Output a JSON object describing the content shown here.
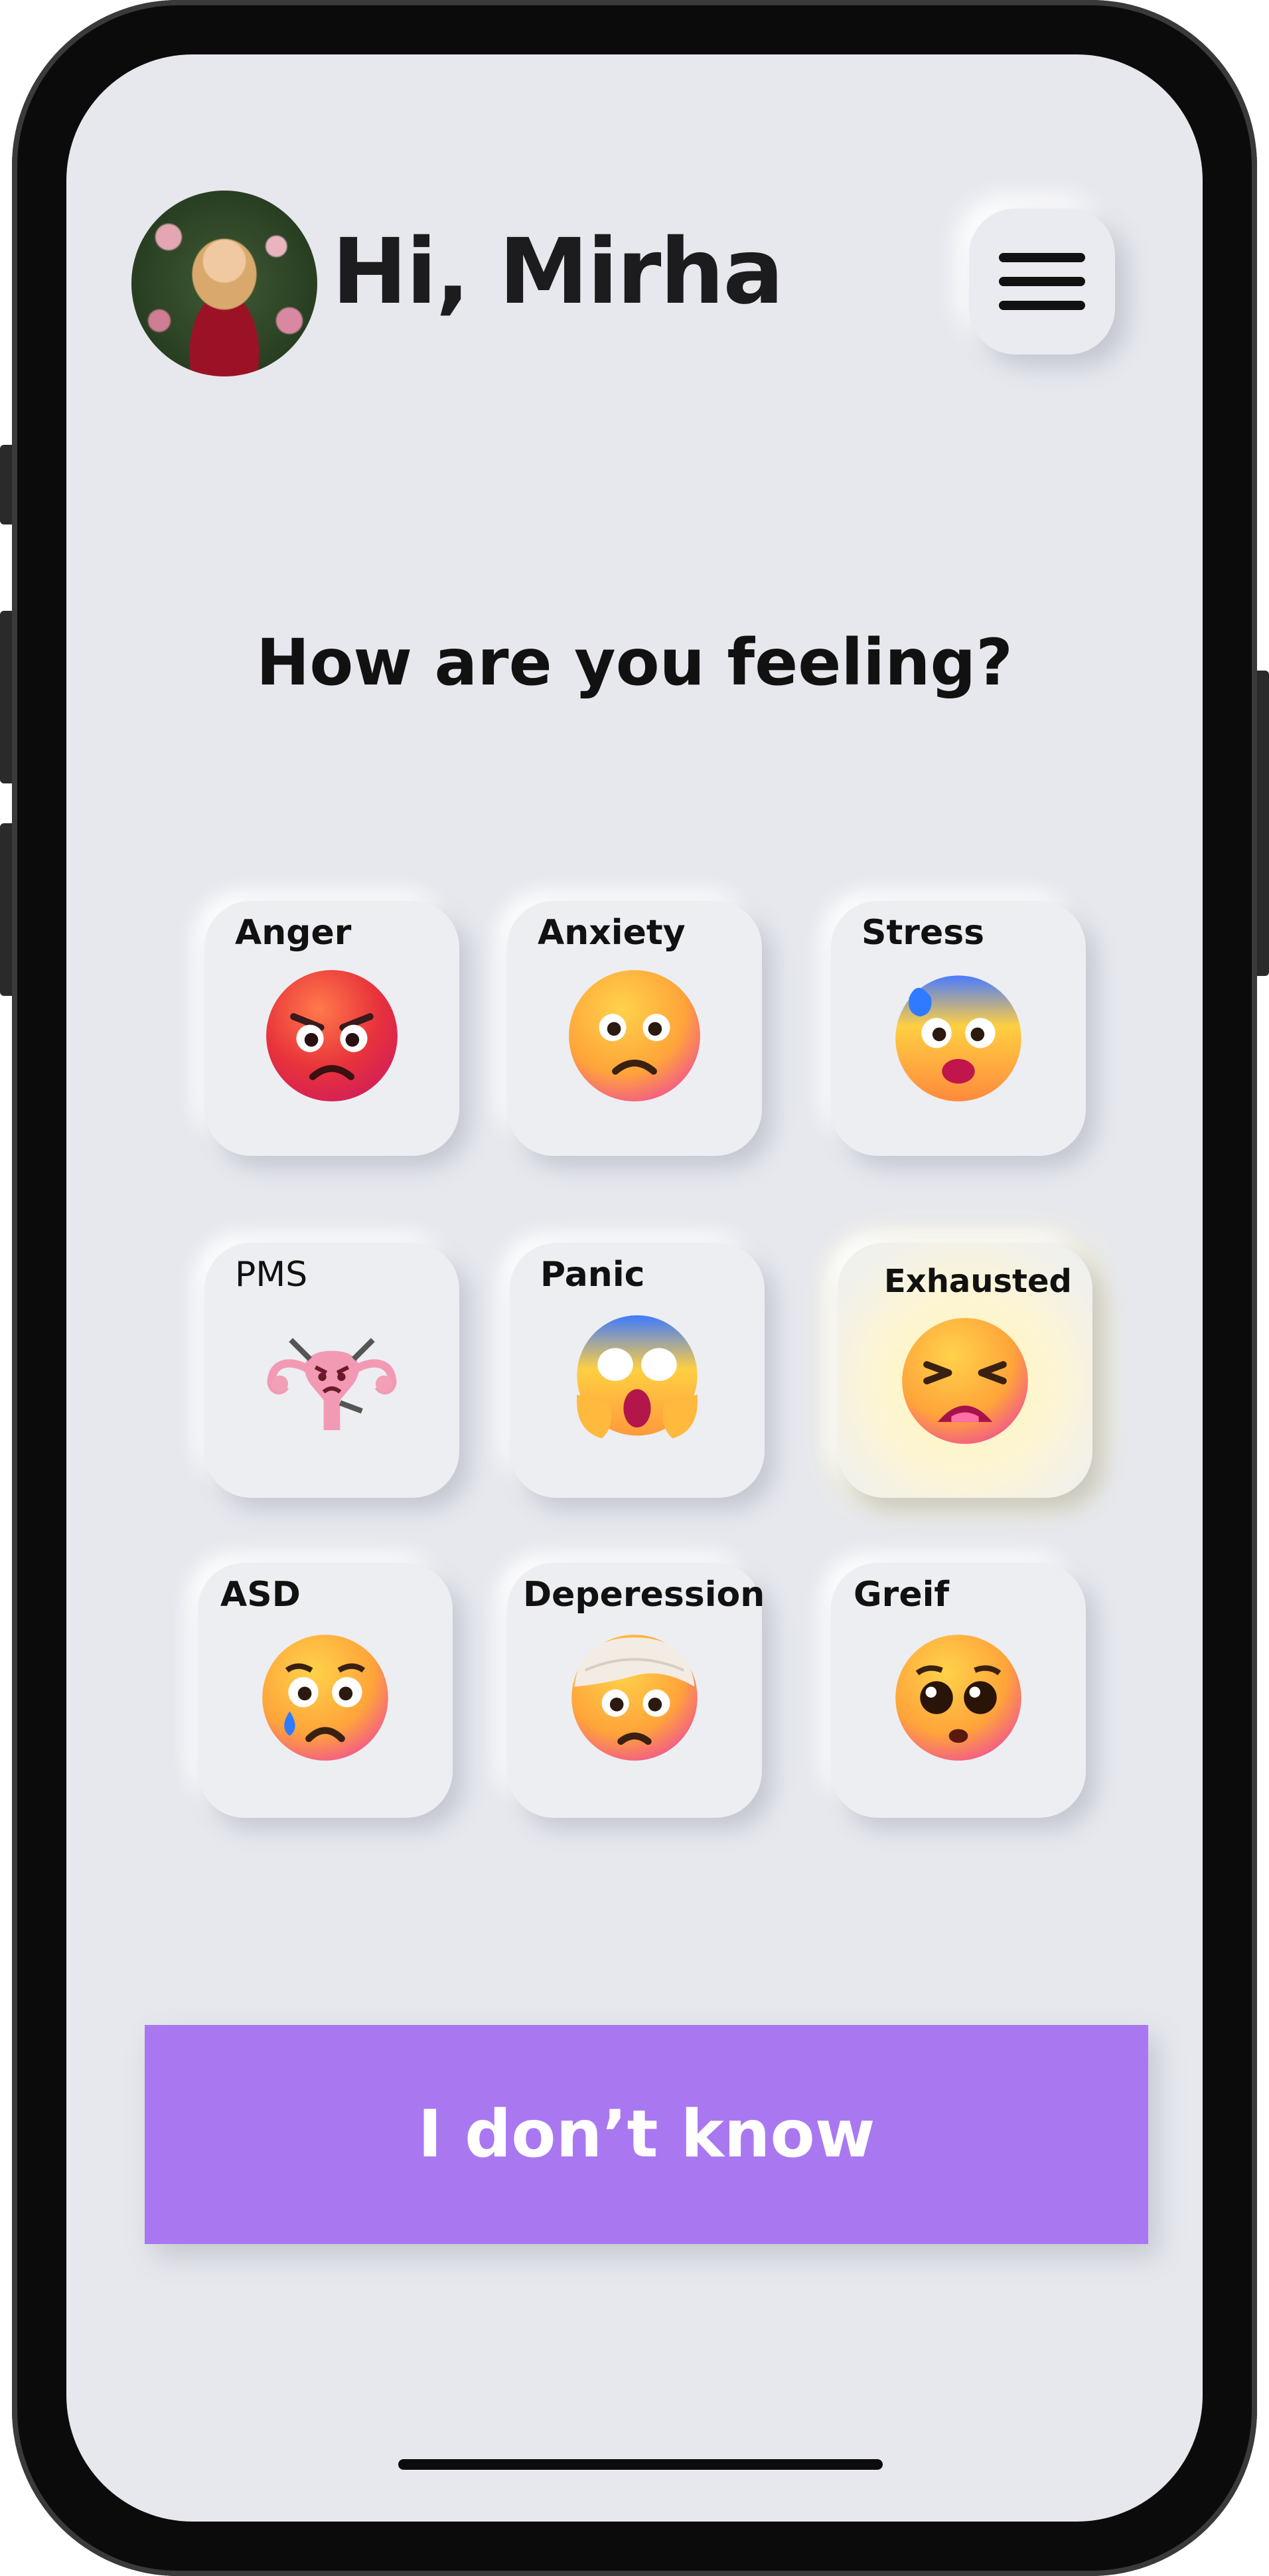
{
  "header": {
    "greeting": "Hi, Mirha"
  },
  "prompt": {
    "question": "How are you feeling?"
  },
  "moods": [
    {
      "label": "Anger",
      "icon": "angry-face-icon"
    },
    {
      "label": "Anxiety",
      "icon": "frowning-face-icon"
    },
    {
      "label": "Stress",
      "icon": "anxious-sweat-face-icon"
    },
    {
      "label": "PMS",
      "icon": "uterus-icon"
    },
    {
      "label": "Panic",
      "icon": "screaming-face-icon"
    },
    {
      "label": "Exhausted",
      "icon": "tired-face-icon",
      "highlighted": true
    },
    {
      "label": "ASD",
      "icon": "tearful-face-icon"
    },
    {
      "label": "Deperession",
      "icon": "bandaged-face-icon"
    },
    {
      "label": "Greif",
      "icon": "pleading-face-icon"
    }
  ],
  "action": {
    "label": "I don’t know"
  },
  "colors": {
    "background": "#e6e8ee",
    "accent": "#a978f1",
    "highlight": "#fdf3c0"
  }
}
